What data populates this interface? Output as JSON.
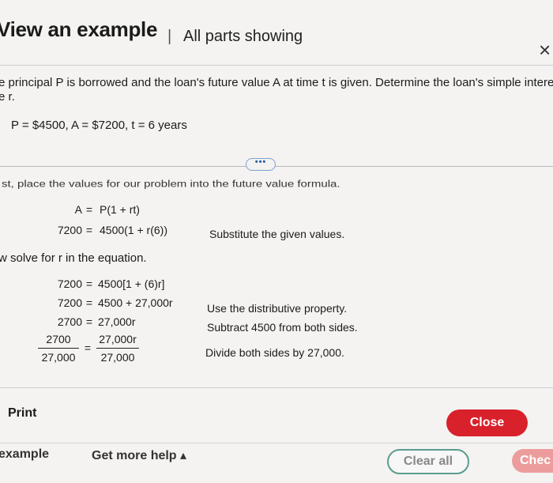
{
  "header": {
    "title": "View an example",
    "separator": "|",
    "subtitle": "All parts showing",
    "close_icon": "×"
  },
  "problem": {
    "line1": "e principal P is borrowed and the loan's future value A at time t is given. Determine the loan's simple intere",
    "line2": "e r.",
    "given": "P = $4500, A = $7200, t = 6 years"
  },
  "more_button": "•••",
  "step1": {
    "text": "st, place the values for our problem into the future value formula.",
    "rows": [
      {
        "lhs": "A",
        "eq": "=",
        "rhs": "P(1 + rt)",
        "note": ""
      },
      {
        "lhs": "7200",
        "eq": "=",
        "rhs": "4500(1 + r(6))",
        "note": "Substitute the given values."
      }
    ]
  },
  "step2": {
    "text": "w solve for r in the equation.",
    "rows": [
      {
        "lhs": "7200",
        "eq": "=",
        "rhs": "4500[1 + (6)r]",
        "note": ""
      },
      {
        "lhs": "7200",
        "eq": "=",
        "rhs": "4500 + 27,000r",
        "note": "Use the distributive property."
      },
      {
        "lhs": "2700",
        "eq": "=",
        "rhs": "27,000r",
        "note": "Subtract 4500 from both sides."
      }
    ],
    "fraction": {
      "lhs_num": "2700",
      "lhs_den": "27,000",
      "eq": "=",
      "rhs_num": "27,000r",
      "rhs_den": "27,000",
      "note": "Divide both sides by 27,000."
    }
  },
  "footer": {
    "print": "Print",
    "close": "Close"
  },
  "bottom": {
    "example": "example",
    "help": "Get more help ▴",
    "clear": "Clear all",
    "check": "Chec"
  },
  "colors": {
    "close_button": "#d8212a",
    "clear_border": "#5a9c8e",
    "check_button": "#ec9c9c",
    "link_blue": "#2a5da8"
  }
}
